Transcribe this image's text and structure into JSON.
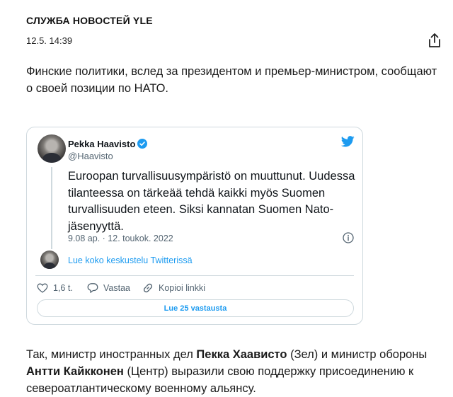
{
  "article": {
    "source": "СЛУЖБА НОВОСТЕЙ YLE",
    "timestamp": "12.5. 14:39",
    "intro": "Финские политики, вслед за президентом и премьер-министром, сообщают о своей позиции по НАТО."
  },
  "tweet": {
    "author_name": "Pekka Haavisto",
    "handle": "@Haavisto",
    "text": "Euroopan turvallisuusympäristö on muuttunut. Uudessa tilanteessa on tärkeää tehdä kaikki myös Suomen turvallisuuden eteen. Siksi kannatan Suomen Nato-jäsenyyttä.",
    "date": "9.08 ap. · 12. toukok. 2022",
    "conversation_link": "Lue koko keskustelu Twitterissä",
    "actions": {
      "likes": "1,6 t.",
      "reply": "Vastaa",
      "copy_link": "Kopioi linkki"
    },
    "replies_button": "Lue 25 vastausta",
    "brand_color": "#1d9bf0"
  },
  "paragraph": {
    "p1": "Так, министр иностранных дел ",
    "b1": "Пекка Хаависто",
    "p2": " (Зел) и министр обороны ",
    "b2": "Антти Кайкконен",
    "p3": " (Центр) выразили свою поддержку присоединению к североатлантическому военному альянсу."
  },
  "icons": [
    "share-icon",
    "verified-badge-icon",
    "twitter-bird-icon",
    "info-icon",
    "heart-icon",
    "reply-icon",
    "link-icon"
  ]
}
